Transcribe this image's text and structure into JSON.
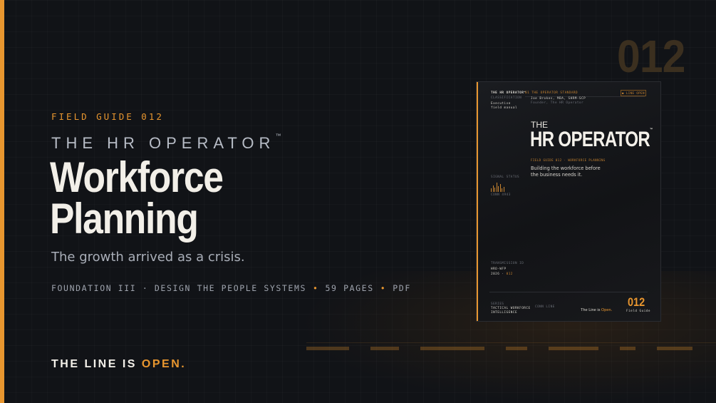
{
  "hero": {
    "big_number": "012",
    "kicker": "FIELD GUIDE 012",
    "series_name": "THE HR OPERATOR",
    "trademark": "™",
    "title_line1": "Workforce",
    "title_line2": "Planning",
    "subtitle": "The growth arrived as a crisis.",
    "meta_part1": "FOUNDATION III · DESIGN THE PEOPLE SYSTEMS",
    "meta_sep": "•",
    "meta_part2": "59 PAGES",
    "meta_part3": "PDF",
    "tagline_prefix": "THE LINE IS ",
    "tagline_highlight": "OPEN."
  },
  "cover": {
    "brand": "THE HR OPERATOR™",
    "classification_label": "CLASSIFICATION",
    "classification_line1": "Executive",
    "classification_line2": "field manual",
    "standard_label": "01 THE OPERATOR STANDARD",
    "author": "Joe Brokes, MBA, SHRM-SCP",
    "author_role": "Founder, The HR Operator",
    "badge": "● LINE OPEN",
    "the": "THE",
    "title": "HR OPERATOR",
    "trademark": "™",
    "guide_label": "FIELD GUIDE 012 · WORKFORCE PLANNING",
    "description": "Building the workforce before the business needs it.",
    "signal_label": "SIGNAL STATUS",
    "signal_value": "CONN 4943",
    "transmission_label": "TRANSMISSION ID",
    "transmission_line1": "HRO-WFP",
    "transmission_line2a": "2026 ·",
    "transmission_line2b": "012",
    "series_label": "SERIES",
    "series_line1": "TACTICAL WORKFORCE",
    "series_line2": "INTELLIGENCE",
    "foot_label": "CONN LINE",
    "foot_tagline_prefix": "The Line is ",
    "foot_tagline_highlight": "Open.",
    "number": "012",
    "number_label": "Field Guide"
  },
  "colors": {
    "accent": "#e8962f",
    "background": "#111317",
    "title_text": "#f2efe8",
    "ghost_number": "#3b2f1f"
  },
  "icons": [
    "signal-wave-icon"
  ]
}
